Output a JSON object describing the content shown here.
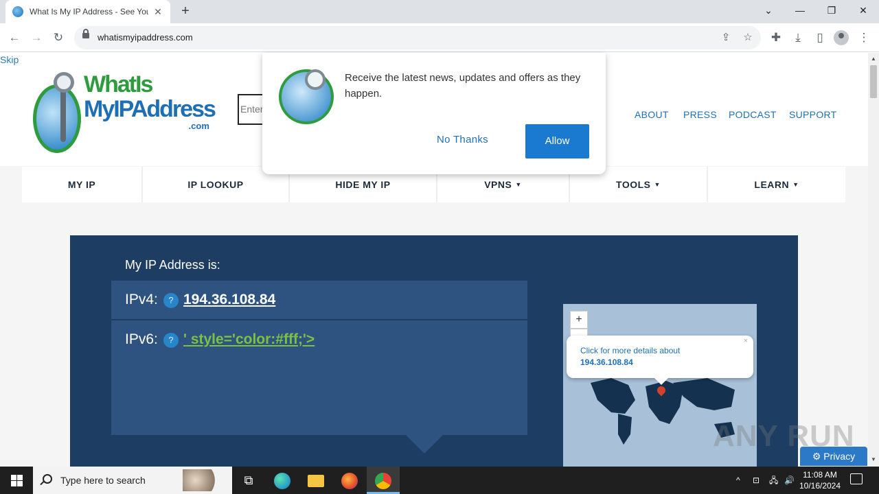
{
  "browser": {
    "tab_title": "What Is My IP Address - See You",
    "tab_close": "✕",
    "new_tab": "+",
    "url": "whatismyipaddress.com",
    "window_controls": {
      "dropdown": "⌄",
      "minimize": "—",
      "restore": "❐",
      "close": "✕"
    },
    "nav": {
      "back": "←",
      "forward": "→",
      "reload": "↻"
    },
    "toolbar_icons": {
      "share": "⇪",
      "star": "☆",
      "extensions": "✚",
      "download": "⤓",
      "sidepanel": "▯",
      "menu": "⋮"
    }
  },
  "site": {
    "skip_link": "Skip",
    "logo": {
      "line1": "WhatIs",
      "line2": "MyIPAddress",
      "line3": ".com"
    },
    "search_placeholder": "Enter",
    "top_nav": [
      "ABOUT",
      "PRESS",
      "PODCAST",
      "SUPPORT"
    ],
    "main_nav": [
      {
        "label": "MY IP",
        "caret": ""
      },
      {
        "label": "IP LOOKUP",
        "caret": ""
      },
      {
        "label": "HIDE MY IP",
        "caret": ""
      },
      {
        "label": "VPNS",
        "caret": "▼"
      },
      {
        "label": "TOOLS",
        "caret": "▼"
      },
      {
        "label": "LEARN",
        "caret": "▼"
      }
    ],
    "ip_panel": {
      "heading": "My IP Address is:",
      "ipv4_label": "IPv4:",
      "ipv4_value": "194.36.108.84",
      "ipv6_label": "IPv6:",
      "ipv6_value": "' style='color:#fff;'>",
      "help": "?",
      "ipv4_color": "#ffffff",
      "ipv6_color": "#7cc242"
    },
    "map": {
      "zoom_in": "+",
      "zoom_out": "−",
      "popup_text": "Click for more details about",
      "popup_ip": "194.36.108.84",
      "popup_close": "×"
    },
    "privacy_button": "Privacy",
    "watermark": "ANY RUN"
  },
  "notification": {
    "message": "Receive the latest news, updates and offers as they happen.",
    "no_thanks": "No Thanks",
    "allow": "Allow"
  },
  "taskbar": {
    "search_placeholder": "Type here to search",
    "time": "11:08 AM",
    "date": "10/16/2024",
    "tray_chevron": "^"
  },
  "colors": {
    "accent_blue": "#1e6fb5",
    "panel_bg": "#1d3d63",
    "row_bg": "#2e5381",
    "allow_button": "#1a7ad0"
  }
}
